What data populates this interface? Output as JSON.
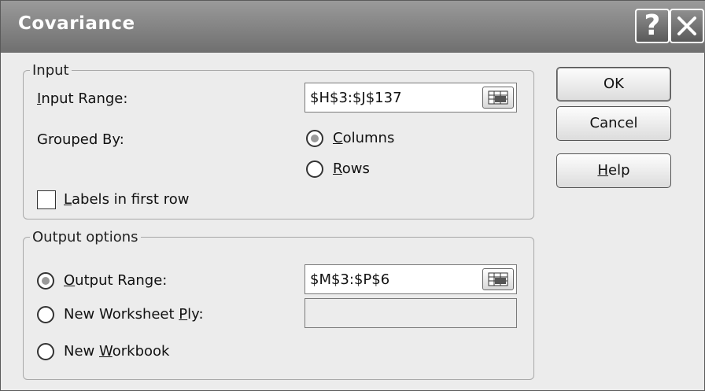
{
  "dialog": {
    "title": "Covariance",
    "help_glyph": "?",
    "close_icon": "close-icon"
  },
  "input_group": {
    "legend": "Input",
    "input_range_label": "Input Range:",
    "input_range_value": "$H$3:$J$137",
    "grouped_by_label": "Grouped By:",
    "columns_label": "Columns",
    "rows_label": "Rows",
    "grouped_by_selected": "Columns",
    "labels_checkbox_label": "Labels in first row",
    "labels_checked": false
  },
  "output_group": {
    "legend": "Output options",
    "output_range_label": "Output Range:",
    "output_range_value": "$M$3:$P$6",
    "new_worksheet_label": "New Worksheet Ply:",
    "new_worksheet_value": "",
    "new_workbook_label": "New Workbook",
    "selected": "Output Range"
  },
  "buttons": {
    "ok": "OK",
    "cancel": "Cancel",
    "help": "Help"
  }
}
